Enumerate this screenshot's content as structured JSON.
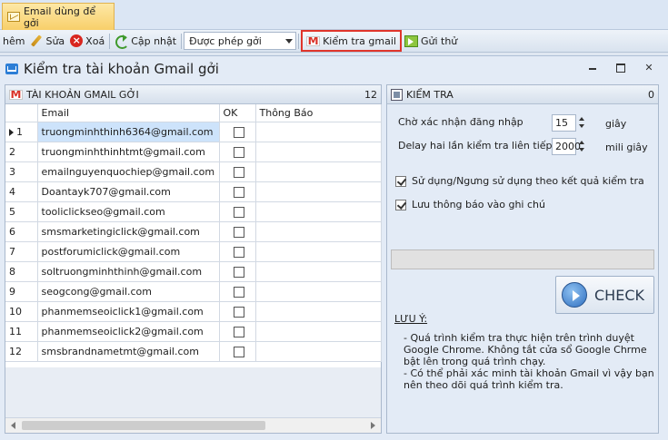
{
  "ribbon": {
    "tab_label": "Email dùng để gởi"
  },
  "toolbar": {
    "partial_label": "hêm",
    "edit_label": "Sửa",
    "delete_label": "Xoá",
    "update_label": "Cập nhật",
    "permission_select": "Được phép gởi",
    "check_gmail_label": "Kiểm tra gmail",
    "send_test_label": "Gửi thử"
  },
  "window": {
    "title": "Kiểm tra tài khoản Gmail gởi"
  },
  "accounts_panel": {
    "title": "TÀI KHOẢN GMAIL GỞI",
    "count": "12",
    "columns": [
      "Email",
      "OK",
      "Thông Báo"
    ],
    "rows": [
      {
        "num": "1",
        "email": "truongminhthinh6364@gmail.com"
      },
      {
        "num": "2",
        "email": "truongminhthinhtmt@gmail.com"
      },
      {
        "num": "3",
        "email": "emailnguyenquochiep@gmail.com"
      },
      {
        "num": "4",
        "email": "Doantayk707@gmail.com"
      },
      {
        "num": "5",
        "email": "tooliclickseo@gmail.com"
      },
      {
        "num": "6",
        "email": "smsmarketingiclick@gmail.com"
      },
      {
        "num": "7",
        "email": "postforumiclick@gmail.com"
      },
      {
        "num": "8",
        "email": "soltruongminhthinh@gmail.com"
      },
      {
        "num": "9",
        "email": "seogcong@gmail.com"
      },
      {
        "num": "10",
        "email": "phanmemseoiclick1@gmail.com"
      },
      {
        "num": "11",
        "email": "phanmemseoiclick2@gmail.com"
      },
      {
        "num": "12",
        "email": "smsbrandnametmt@gmail.com"
      }
    ]
  },
  "check_panel": {
    "title": "KIỂM TRA",
    "count": "0",
    "login_wait_label": "Chờ xác nhận đăng nhập",
    "login_wait_value": "15",
    "login_wait_unit": "giây",
    "delay_label": "Delay hai lần kiểm tra liên tiếp",
    "delay_value": "2000",
    "delay_unit": "mili giây",
    "use_result_label": "Sử dụng/Ngưng sử dụng theo kết quả kiểm tra",
    "save_note_label": "Lưu thông báo vào ghi chú",
    "check_button": "CHECK",
    "note_title": "LƯU Ý:",
    "note_text": "- Quá trình kiểm tra thực hiện trên trình duyệt\nGoogle Chrome. Không tắt cửa sổ Google Chrme\nbật lên trong quá trình chạy.\n- Có thể phải xác minh tài khoản Gmail vì vậy bạn\nnên theo dõi quá trình kiểm tra."
  }
}
